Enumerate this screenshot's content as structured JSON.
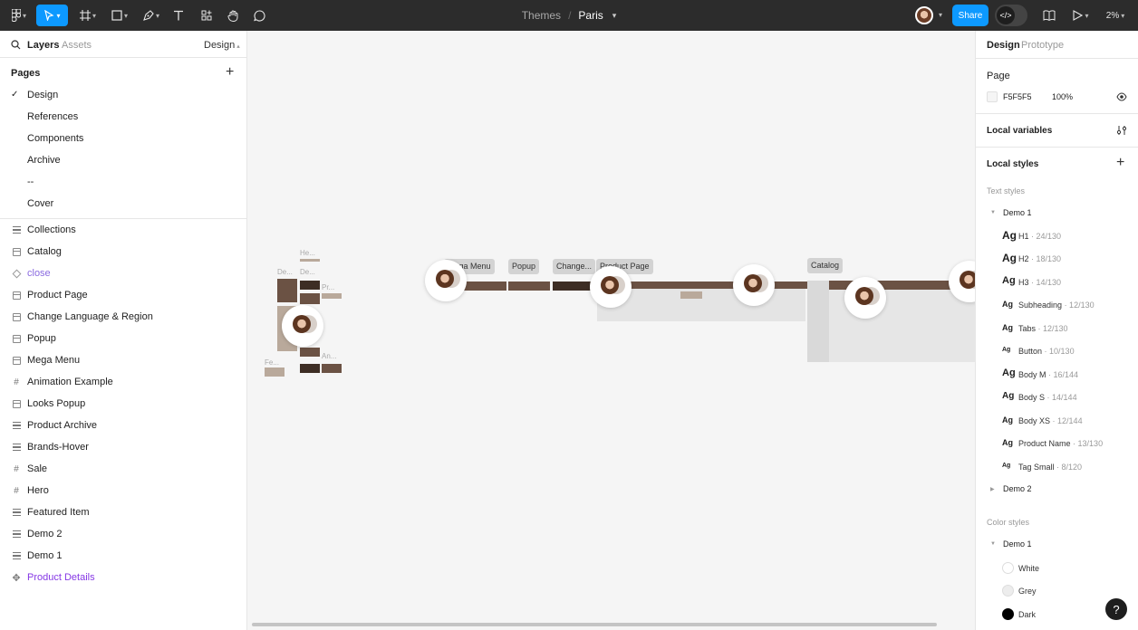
{
  "toolbar": {
    "file_name": "Paris",
    "project_name": "Themes",
    "separator": "/",
    "share_label": "Share",
    "zoom": "2%",
    "tools": [
      "figma-menu-icon",
      "move-icon",
      "frame-icon",
      "shape-icon",
      "pen-icon",
      "text-icon",
      "resources-icon",
      "hand-icon",
      "comment-icon"
    ]
  },
  "left_panel": {
    "tabs": {
      "layers": "Layers",
      "assets": "Assets",
      "page_selector": "Design"
    },
    "pages_title": "Pages",
    "pages": [
      {
        "label": "Design",
        "selected": true
      },
      {
        "label": "References",
        "selected": false
      },
      {
        "label": "Components",
        "selected": false
      },
      {
        "label": "Archive",
        "selected": false
      },
      {
        "label": "--",
        "selected": false
      },
      {
        "label": "Cover",
        "selected": false
      }
    ],
    "layers": [
      {
        "label": "Collections",
        "icon": "section-icon"
      },
      {
        "label": "Catalog",
        "icon": "frame-icon"
      },
      {
        "label": "close",
        "icon": "component-icon"
      },
      {
        "label": "Product Page",
        "icon": "frame-icon"
      },
      {
        "label": "Change Language & Region",
        "icon": "frame-icon"
      },
      {
        "label": "Popup",
        "icon": "frame-icon"
      },
      {
        "label": "Mega Menu",
        "icon": "frame-icon"
      },
      {
        "label": "Animation Example",
        "icon": "hash-icon"
      },
      {
        "label": "Looks Popup",
        "icon": "frame-icon"
      },
      {
        "label": "Product Archive",
        "icon": "section-icon"
      },
      {
        "label": "Brands-Hover",
        "icon": "section-icon"
      },
      {
        "label": "Sale",
        "icon": "hash-icon"
      },
      {
        "label": "Hero",
        "icon": "hash-icon"
      },
      {
        "label": "Featured Item",
        "icon": "section-icon"
      },
      {
        "label": "Demo 2",
        "icon": "section-icon"
      },
      {
        "label": "Demo 1",
        "icon": "section-icon"
      },
      {
        "label": "Product Details",
        "icon": "component-set-icon"
      }
    ]
  },
  "canvas": {
    "frame_labels": [
      "Mega Menu",
      "Popup",
      "Change...",
      "Product Page",
      "Catalog"
    ],
    "tiny_labels": [
      "He...",
      "De...",
      "De...",
      "Pr...",
      "Fe...",
      "An..."
    ]
  },
  "right_panel": {
    "tabs": {
      "design": "Design",
      "prototype": "Prototype"
    },
    "page_section": "Page",
    "page_color": "F5F5F5",
    "page_opacity": "100%",
    "local_variables": "Local variables",
    "local_styles": "Local styles",
    "text_styles_title": "Text styles",
    "text_group_1": "Demo 1",
    "text_styles": [
      {
        "name": "H1",
        "meta": "· 24/130",
        "size": "large"
      },
      {
        "name": "H2",
        "meta": "· 18/130",
        "size": "large"
      },
      {
        "name": "H3",
        "meta": "· 14/130",
        "size": "large"
      },
      {
        "name": "Subheading",
        "meta": "· 12/130",
        "size": "medium"
      },
      {
        "name": "Tabs",
        "meta": "· 12/130",
        "size": "medium"
      },
      {
        "name": "Button",
        "meta": "· 10/130",
        "size": "small"
      },
      {
        "name": "Body M",
        "meta": "· 16/144",
        "size": "large"
      },
      {
        "name": "Body S",
        "meta": "· 14/144",
        "size": "medium"
      },
      {
        "name": "Body XS",
        "meta": "· 12/144",
        "size": "medium"
      },
      {
        "name": "Product Name",
        "meta": "· 13/130",
        "size": "medium"
      },
      {
        "name": "Tag Small",
        "meta": "· 8/120",
        "size": "small"
      }
    ],
    "ag_glyph": "Ag",
    "text_group_2": "Demo 2",
    "color_styles_title": "Color styles",
    "color_group_1": "Demo 1",
    "color_styles": [
      {
        "name": "White",
        "hex": "#FFFFFF"
      },
      {
        "name": "Grey",
        "hex": "#EDEDED"
      },
      {
        "name": "Dark",
        "hex": "#000000"
      }
    ],
    "help_label": "?"
  },
  "colors": {
    "toolbar_bg": "#2C2C2C",
    "accent": "#0D99FF",
    "component_purple": "#8638E5",
    "canvas_bg": "#F5F5F5"
  }
}
